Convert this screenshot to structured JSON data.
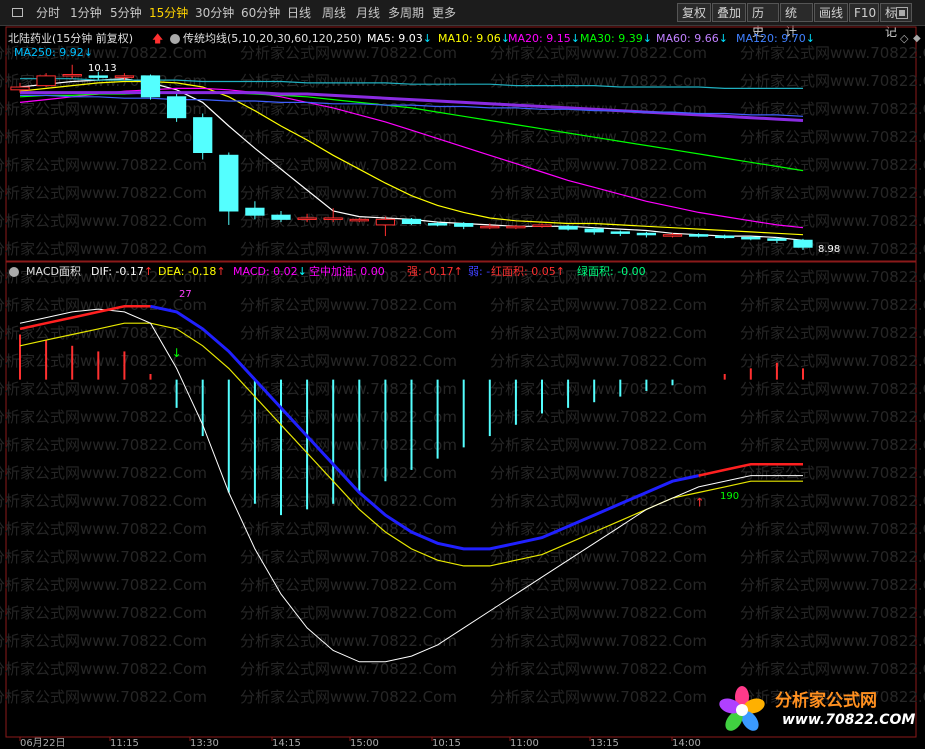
{
  "toolbar": {
    "periods": [
      "分时",
      "1分钟",
      "5分钟",
      "15分钟",
      "30分钟",
      "60分钟",
      "日线",
      "周线",
      "月线",
      "多周期",
      "更多"
    ],
    "active_index": 3,
    "tools": [
      "复权",
      "叠加",
      "历史",
      "统计",
      "画线",
      "F10",
      "标记"
    ]
  },
  "main_panel": {
    "stock_title": "北陆药业(15分钟 前复权)",
    "indicator_name": "传统均线(5,10,20,30,60,120,250)",
    "ma_labels": [
      {
        "text": "MA5: 9.03",
        "arrow": "↓",
        "color": "#ffffff"
      },
      {
        "text": "MA10: 9.06",
        "arrow": "↓",
        "color": "#ffff00"
      },
      {
        "text": "MA20: 9.15",
        "arrow": "↓",
        "color": "#ff00ff"
      },
      {
        "text": "MA30: 9.39",
        "arrow": "↓",
        "color": "#00ff00"
      },
      {
        "text": "MA60: 9.66",
        "arrow": "↓",
        "color": "#c080ff"
      },
      {
        "text": "MA120: 9.70",
        "arrow": "↓",
        "color": "#4080ff"
      }
    ],
    "ma250_label": {
      "text": "MA250: 9.92",
      "arrow": "↓",
      "color": "#00c0ff"
    },
    "high_label": "10.13",
    "low_label": "8.98"
  },
  "sub_panel": {
    "indicator_name": "MACD面积",
    "labels": [
      {
        "text": "DIF: -0.17",
        "arrow": "↑",
        "color": "#ffffff",
        "arrow_color": "#ff3030"
      },
      {
        "text": "DEA: -0.18",
        "arrow": "↑",
        "color": "#ffff00",
        "arrow_color": "#ff3030"
      },
      {
        "text": "MACD: 0.02",
        "arrow": "↓",
        "color": "#ff00ff",
        "arrow_color": "#00ffff"
      },
      {
        "text": "空中加油: 0.00",
        "arrow": "",
        "color": "#ff00ff",
        "arrow_color": ""
      },
      {
        "text": "强: -0.17",
        "arrow": "↑",
        "color": "#ff3030",
        "arrow_color": "#ff3030"
      },
      {
        "text": "弱: -",
        "arrow": "",
        "color": "#4040ff",
        "arrow_color": ""
      },
      {
        "text": "红面积: 0.05",
        "arrow": "↑",
        "color": "#ff3030",
        "arrow_color": "#ff3030"
      },
      {
        "text": "绿面积: -0.00",
        "arrow": "",
        "color": "#00ff80",
        "arrow_color": ""
      }
    ],
    "annotation_top": "27",
    "annotation_bottom": "190"
  },
  "x_axis_labels": [
    "06月22日",
    "11:15",
    "13:30",
    "14:15",
    "15:00",
    "10:15",
    "11:00",
    "13:15",
    "14:00"
  ],
  "watermark": "分析家公式网www.70822.Com",
  "logo": {
    "name": "分析家公式网",
    "url": "www.70822.COM"
  },
  "colors": {
    "up": "#ff3030",
    "down": "#54ffff",
    "background": "#000000"
  },
  "chart_data": [
    {
      "type": "candlestick",
      "title": "北陆药业(15分钟 前复权)",
      "candles": [
        {
          "o": 9.95,
          "c": 9.97,
          "h": 10.0,
          "l": 9.93
        },
        {
          "o": 9.98,
          "c": 10.05,
          "h": 10.07,
          "l": 9.97
        },
        {
          "o": 10.05,
          "c": 10.06,
          "h": 10.13,
          "l": 10.03
        },
        {
          "o": 10.05,
          "c": 10.04,
          "h": 10.08,
          "l": 10.02
        },
        {
          "o": 10.04,
          "c": 10.05,
          "h": 10.07,
          "l": 10.02
        },
        {
          "o": 10.05,
          "c": 9.9,
          "h": 10.06,
          "l": 9.88
        },
        {
          "o": 9.9,
          "c": 9.75,
          "h": 9.92,
          "l": 9.72
        },
        {
          "o": 9.75,
          "c": 9.5,
          "h": 9.78,
          "l": 9.45
        },
        {
          "o": 9.48,
          "c": 9.08,
          "h": 9.5,
          "l": 8.98
        },
        {
          "o": 9.1,
          "c": 9.05,
          "h": 9.15,
          "l": 9.02
        },
        {
          "o": 9.05,
          "c": 9.02,
          "h": 9.08,
          "l": 9.0
        },
        {
          "o": 9.02,
          "c": 9.03,
          "h": 9.06,
          "l": 9.0
        },
        {
          "o": 9.03,
          "c": 9.03,
          "h": 9.1,
          "l": 9.0
        },
        {
          "o": 9.02,
          "c": 9.02,
          "h": 9.03,
          "l": 9.0
        },
        {
          "o": 8.98,
          "c": 9.02,
          "h": 9.04,
          "l": 8.9
        },
        {
          "o": 9.02,
          "c": 8.99,
          "h": 9.03,
          "l": 8.98
        },
        {
          "o": 8.99,
          "c": 8.98,
          "h": 9.0,
          "l": 8.97
        },
        {
          "o": 8.99,
          "c": 8.97,
          "h": 9.0,
          "l": 8.95
        },
        {
          "o": 8.97,
          "c": 8.97,
          "h": 8.99,
          "l": 8.95
        },
        {
          "o": 8.96,
          "c": 8.97,
          "h": 8.98,
          "l": 8.95
        },
        {
          "o": 8.97,
          "c": 8.98,
          "h": 8.99,
          "l": 8.96
        },
        {
          "o": 8.97,
          "c": 8.95,
          "h": 8.98,
          "l": 8.94
        },
        {
          "o": 8.95,
          "c": 8.93,
          "h": 8.96,
          "l": 8.91
        },
        {
          "o": 8.93,
          "c": 8.92,
          "h": 8.94,
          "l": 8.9
        },
        {
          "o": 8.92,
          "c": 8.91,
          "h": 8.93,
          "l": 8.89
        },
        {
          "o": 8.9,
          "c": 8.91,
          "h": 8.92,
          "l": 8.89
        },
        {
          "o": 8.91,
          "c": 8.9,
          "h": 8.92,
          "l": 8.89
        },
        {
          "o": 8.9,
          "c": 8.89,
          "h": 8.91,
          "l": 8.88
        },
        {
          "o": 8.89,
          "c": 8.88,
          "h": 8.9,
          "l": 8.87
        },
        {
          "o": 8.88,
          "c": 8.87,
          "h": 8.89,
          "l": 8.85
        },
        {
          "o": 8.87,
          "c": 8.82,
          "h": 8.88,
          "l": 8.8
        }
      ],
      "moving_averages": [
        {
          "name": "MA5",
          "color": "#ffffff",
          "values": [
            9.97,
            9.99,
            10.01,
            10.02,
            10.03,
            10.0,
            9.95,
            9.86,
            9.69,
            9.53,
            9.38,
            9.23,
            9.08,
            9.04,
            9.03,
            9.02,
            9.0,
            8.99,
            8.98,
            8.97,
            8.97,
            8.97,
            8.96,
            8.95,
            8.94,
            8.92,
            8.91,
            8.9,
            8.9,
            8.89,
            8.87
          ]
        },
        {
          "name": "MA10",
          "color": "#ffff00",
          "values": [
            9.94,
            9.96,
            9.98,
            10.0,
            10.01,
            10.01,
            10.0,
            9.97,
            9.9,
            9.8,
            9.69,
            9.59,
            9.48,
            9.38,
            9.28,
            9.19,
            9.12,
            9.07,
            9.03,
            9.01,
            9.0,
            8.99,
            8.99,
            8.98,
            8.97,
            8.96,
            8.95,
            8.94,
            8.93,
            8.92,
            8.91
          ]
        },
        {
          "name": "MA20",
          "color": "#ff00ff",
          "values": [
            9.86,
            9.88,
            9.9,
            9.92,
            9.94,
            9.95,
            9.96,
            9.96,
            9.95,
            9.93,
            9.9,
            9.86,
            9.82,
            9.77,
            9.72,
            9.66,
            9.6,
            9.54,
            9.48,
            9.42,
            9.36,
            9.3,
            9.25,
            9.2,
            9.15,
            9.11,
            9.07,
            9.04,
            9.01,
            8.98,
            8.96
          ]
        },
        {
          "name": "MA30",
          "color": "#00ff00",
          "values": [
            9.9,
            9.91,
            9.91,
            9.92,
            9.92,
            9.93,
            9.93,
            9.93,
            9.93,
            9.92,
            9.91,
            9.9,
            9.88,
            9.86,
            9.84,
            9.82,
            9.79,
            9.76,
            9.73,
            9.7,
            9.67,
            9.64,
            9.61,
            9.58,
            9.55,
            9.52,
            9.49,
            9.46,
            9.43,
            9.4,
            9.37
          ]
        },
        {
          "name": "MA60",
          "color": "#8a2be2",
          "values": [
            9.93,
            9.93,
            9.93,
            9.93,
            9.93,
            9.93,
            9.93,
            9.93,
            9.93,
            9.93,
            9.92,
            9.92,
            9.91,
            9.9,
            9.89,
            9.88,
            9.87,
            9.86,
            9.85,
            9.84,
            9.83,
            9.82,
            9.81,
            9.8,
            9.79,
            9.78,
            9.77,
            9.76,
            9.75,
            9.74,
            9.73
          ]
        },
        {
          "name": "MA120",
          "color": "#4060ff",
          "values": [
            9.91,
            9.91,
            9.9,
            9.9,
            9.89,
            9.89,
            9.88,
            9.88,
            9.87,
            9.87,
            9.86,
            9.86,
            9.85,
            9.85,
            9.84,
            9.84,
            9.83,
            9.83,
            9.82,
            9.82,
            9.81,
            9.81,
            9.8,
            9.8,
            9.79,
            9.79,
            9.78,
            9.78,
            9.77,
            9.77,
            9.76
          ]
        },
        {
          "name": "MA250",
          "color": "#20b0c0",
          "values": [
            10.03,
            10.03,
            10.03,
            10.02,
            10.02,
            10.02,
            10.02,
            10.01,
            10.01,
            10.01,
            10.01,
            10.0,
            10.0,
            10.0,
            10.0,
            9.99,
            9.99,
            9.99,
            9.99,
            9.98,
            9.98,
            9.98,
            9.98,
            9.97,
            9.97,
            9.97,
            9.97,
            9.96,
            9.96,
            9.96,
            9.96
          ]
        }
      ],
      "ylim": [
        8.8,
        10.2
      ]
    },
    {
      "type": "bar",
      "title": "MACD面积",
      "macd": [
        0.08,
        0.07,
        0.06,
        0.05,
        0.05,
        0.01,
        -0.05,
        -0.1,
        -0.2,
        -0.22,
        -0.24,
        -0.23,
        -0.22,
        -0.2,
        -0.18,
        -0.16,
        -0.14,
        -0.12,
        -0.1,
        -0.08,
        -0.06,
        -0.05,
        -0.04,
        -0.03,
        -0.02,
        -0.01,
        0.0,
        0.01,
        0.02,
        0.03,
        0.02
      ],
      "dif": [
        0.1,
        0.11,
        0.12,
        0.125,
        0.12,
        0.1,
        0.02,
        -0.08,
        -0.2,
        -0.3,
        -0.38,
        -0.44,
        -0.48,
        -0.5,
        -0.5,
        -0.49,
        -0.47,
        -0.44,
        -0.41,
        -0.38,
        -0.35,
        -0.32,
        -0.29,
        -0.26,
        -0.23,
        -0.21,
        -0.19,
        -0.18,
        -0.17,
        -0.17,
        -0.17
      ],
      "dea": [
        0.06,
        0.07,
        0.08,
        0.09,
        0.1,
        0.1,
        0.09,
        0.06,
        0.02,
        -0.03,
        -0.08,
        -0.13,
        -0.18,
        -0.23,
        -0.27,
        -0.3,
        -0.32,
        -0.33,
        -0.33,
        -0.32,
        -0.31,
        -0.29,
        -0.27,
        -0.25,
        -0.23,
        -0.21,
        -0.2,
        -0.19,
        -0.18,
        -0.18,
        -0.18
      ],
      "ylim": [
        -0.55,
        0.15
      ]
    }
  ]
}
